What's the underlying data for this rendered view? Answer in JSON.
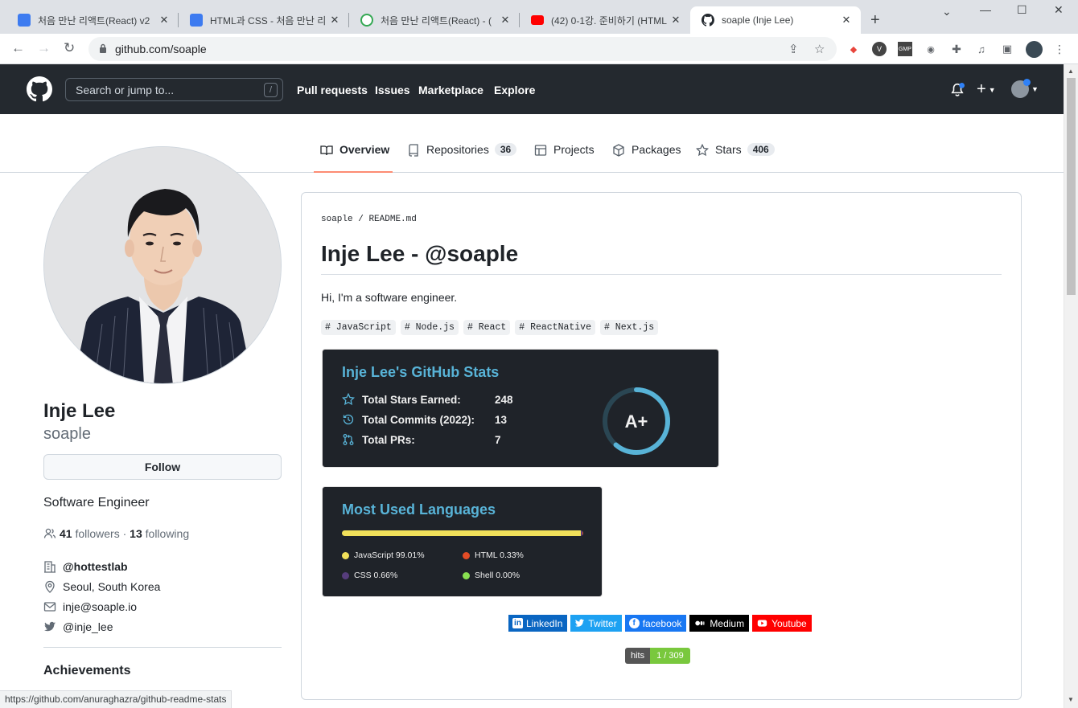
{
  "browser": {
    "tabs": [
      {
        "title": "처음 만난 리액트(React) v2",
        "color": "#3d7bf0"
      },
      {
        "title": "HTML과 CSS - 처음 만난 리",
        "color": "#3d7bf0"
      },
      {
        "title": "처음 만난 리액트(React) - (",
        "color": "#34a853"
      },
      {
        "title": "(42) 0-1강. 준비하기 (HTML",
        "color": "#ff0000"
      },
      {
        "title": "soaple (Inje Lee)",
        "color": "#24292f"
      }
    ],
    "url": "github.com/soaple",
    "status_url": "https://github.com/anuraghazra/github-readme-stats"
  },
  "github": {
    "search_placeholder": "Search or jump to...",
    "search_shortcut": "/",
    "nav": [
      "Pull requests",
      "Issues",
      "Marketplace",
      "Explore"
    ]
  },
  "profile_tabs": [
    {
      "label": "Overview",
      "count": ""
    },
    {
      "label": "Repositories",
      "count": "36"
    },
    {
      "label": "Projects",
      "count": ""
    },
    {
      "label": "Packages",
      "count": ""
    },
    {
      "label": "Stars",
      "count": "406"
    }
  ],
  "profile": {
    "name": "Inje Lee",
    "login": "soaple",
    "follow_label": "Follow",
    "bio": "Software Engineer",
    "followers": "41",
    "followers_label": "followers",
    "following": "13",
    "following_label": "following",
    "org": "@hottestlab",
    "location": "Seoul, South Korea",
    "email": "inje@soaple.io",
    "twitter": "@inje_lee",
    "achievements": "Achievements"
  },
  "readme": {
    "path_user": "soaple",
    "path_sep": "/",
    "path_file": "README.md",
    "title": "Inje Lee - @soaple",
    "intro": "Hi, I'm a software engineer.",
    "tags": [
      "# JavaScript",
      "# Node.js",
      "# React",
      "# ReactNative",
      "# Next.js"
    ],
    "stats": {
      "title": "Inje Lee's GitHub Stats",
      "rows": [
        {
          "label": "Total Stars Earned:",
          "value": "248",
          "icon": "star-icon"
        },
        {
          "label": "Total Commits (2022):",
          "value": "13",
          "icon": "history-icon"
        },
        {
          "label": "Total PRs:",
          "value": "7",
          "icon": "pull-request-icon"
        }
      ],
      "grade": "A+",
      "accent": "#58b3d7"
    },
    "languages": {
      "title": "Most Used Languages",
      "items": [
        {
          "name": "JavaScript",
          "percent": 99.01,
          "label": "JavaScript 99.01%",
          "color": "#f1e05a"
        },
        {
          "name": "HTML",
          "percent": 0.33,
          "label": "HTML 0.33%",
          "color": "#e34c26"
        },
        {
          "name": "CSS",
          "percent": 0.66,
          "label": "CSS 0.66%",
          "color": "#563d7c"
        },
        {
          "name": "Shell",
          "percent": 0.0,
          "label": "Shell 0.00%",
          "color": "#89e051"
        }
      ]
    },
    "badges": [
      {
        "label": "LinkedIn",
        "color": "#0a66c2"
      },
      {
        "label": "Twitter",
        "color": "#1da1f2"
      },
      {
        "label": "facebook",
        "color": "#1877f2"
      },
      {
        "label": "Medium",
        "color": "#000000"
      },
      {
        "label": "Youtube",
        "color": "#ff0000"
      }
    ],
    "hits_label": "hits",
    "hits_value": "1 / 309"
  }
}
